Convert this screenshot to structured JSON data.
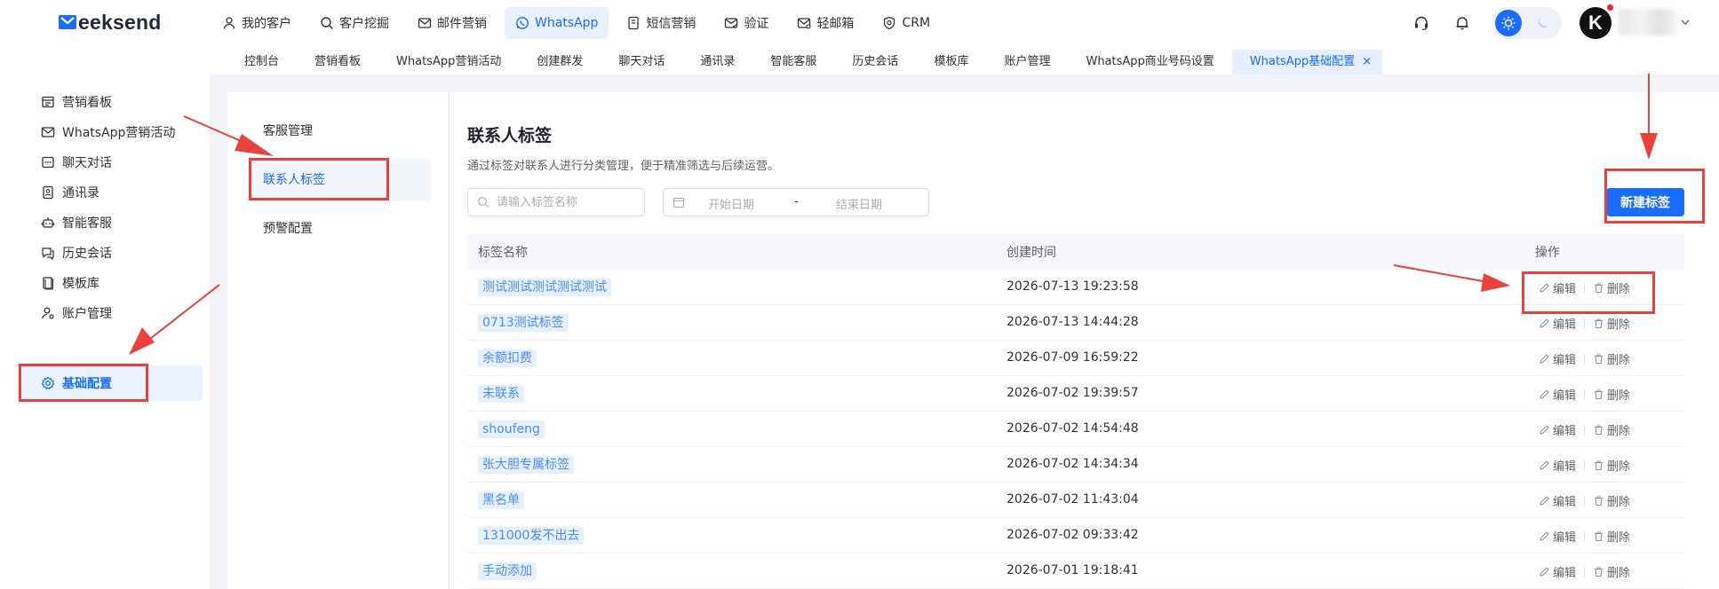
{
  "brand": {
    "logo_text": "eeksend"
  },
  "top_nav": [
    {
      "label": "我的客户",
      "icon": "user-icon"
    },
    {
      "label": "客户挖掘",
      "icon": "search-icon"
    },
    {
      "label": "邮件营销",
      "icon": "mail-icon"
    },
    {
      "label": "WhatsApp",
      "icon": "whatsapp-icon",
      "active": true
    },
    {
      "label": "短信营销",
      "icon": "sms-icon"
    },
    {
      "label": "验证",
      "icon": "mail-check-icon"
    },
    {
      "label": "轻邮箱",
      "icon": "mailbox-icon"
    },
    {
      "label": "CRM",
      "icon": "crm-shield-icon"
    }
  ],
  "header_right": {
    "avatar_text": "K",
    "icons": [
      "headset-icon",
      "bell-icon",
      "sun-icon",
      "moon-icon",
      "chevron-down-icon"
    ]
  },
  "tabs": [
    {
      "label": "控制台"
    },
    {
      "label": "营销看板"
    },
    {
      "label": "WhatsApp营销活动"
    },
    {
      "label": "创建群发"
    },
    {
      "label": "聊天对话"
    },
    {
      "label": "通讯录"
    },
    {
      "label": "智能客服"
    },
    {
      "label": "历史会话"
    },
    {
      "label": "模板库"
    },
    {
      "label": "账户管理"
    },
    {
      "label": "WhatsApp商业号码设置"
    },
    {
      "label": "WhatsApp基础配置",
      "active": true,
      "close": "×"
    }
  ],
  "sidebar": [
    {
      "label": "营销看板",
      "icon": "dashboard-icon"
    },
    {
      "label": "WhatsApp营销活动",
      "icon": "campaign-icon"
    },
    {
      "label": "聊天对话",
      "icon": "chat-icon"
    },
    {
      "label": "通讯录",
      "icon": "contacts-icon"
    },
    {
      "label": "智能客服",
      "icon": "robot-icon"
    },
    {
      "label": "历史会话",
      "icon": "history-chat-icon"
    },
    {
      "label": "模板库",
      "icon": "template-icon"
    },
    {
      "label": "账户管理",
      "icon": "account-icon"
    },
    {
      "label": "基础配置",
      "icon": "settings-icon",
      "active": true
    }
  ],
  "sub_nav": [
    {
      "label": "客服管理"
    },
    {
      "label": "联系人标签",
      "active": true
    },
    {
      "label": "预警配置"
    }
  ],
  "page": {
    "title": "联系人标签",
    "description": "通过标签对联系人进行分类管理，便于精准筛选与后续运营。",
    "search_placeholder": "请输入标签名称",
    "start_date_placeholder": "开始日期",
    "date_separator": "-",
    "end_date_placeholder": "结束日期",
    "new_button": "新建标签"
  },
  "table": {
    "columns": [
      "标签名称",
      "创建时间",
      "操作"
    ],
    "edit_label": "编辑",
    "delete_label": "删除",
    "rows": [
      {
        "name": "测试测试测试测试测试",
        "created": "2026-07-13 19:23:58"
      },
      {
        "name": "0713测试标签",
        "created": "2026-07-13 14:44:28"
      },
      {
        "name": "余额扣费",
        "created": "2026-07-09 16:59:22"
      },
      {
        "name": "未联系",
        "created": "2026-07-02 19:39:57"
      },
      {
        "name": "shoufeng",
        "created": "2026-07-02 14:54:48"
      },
      {
        "name": "张大胆专属标签",
        "created": "2026-07-02 14:34:34"
      },
      {
        "name": "黑名单",
        "created": "2026-07-02 11:43:04"
      },
      {
        "name": "131000发不出去",
        "created": "2026-07-02 09:33:42"
      },
      {
        "name": "手动添加",
        "created": "2026-07-01 19:18:41"
      }
    ]
  },
  "colors": {
    "primary": "#1a6cff",
    "annotation_red": "#e8413e",
    "tag_bg": "#e6efff",
    "tag_text": "#4a8cff"
  }
}
